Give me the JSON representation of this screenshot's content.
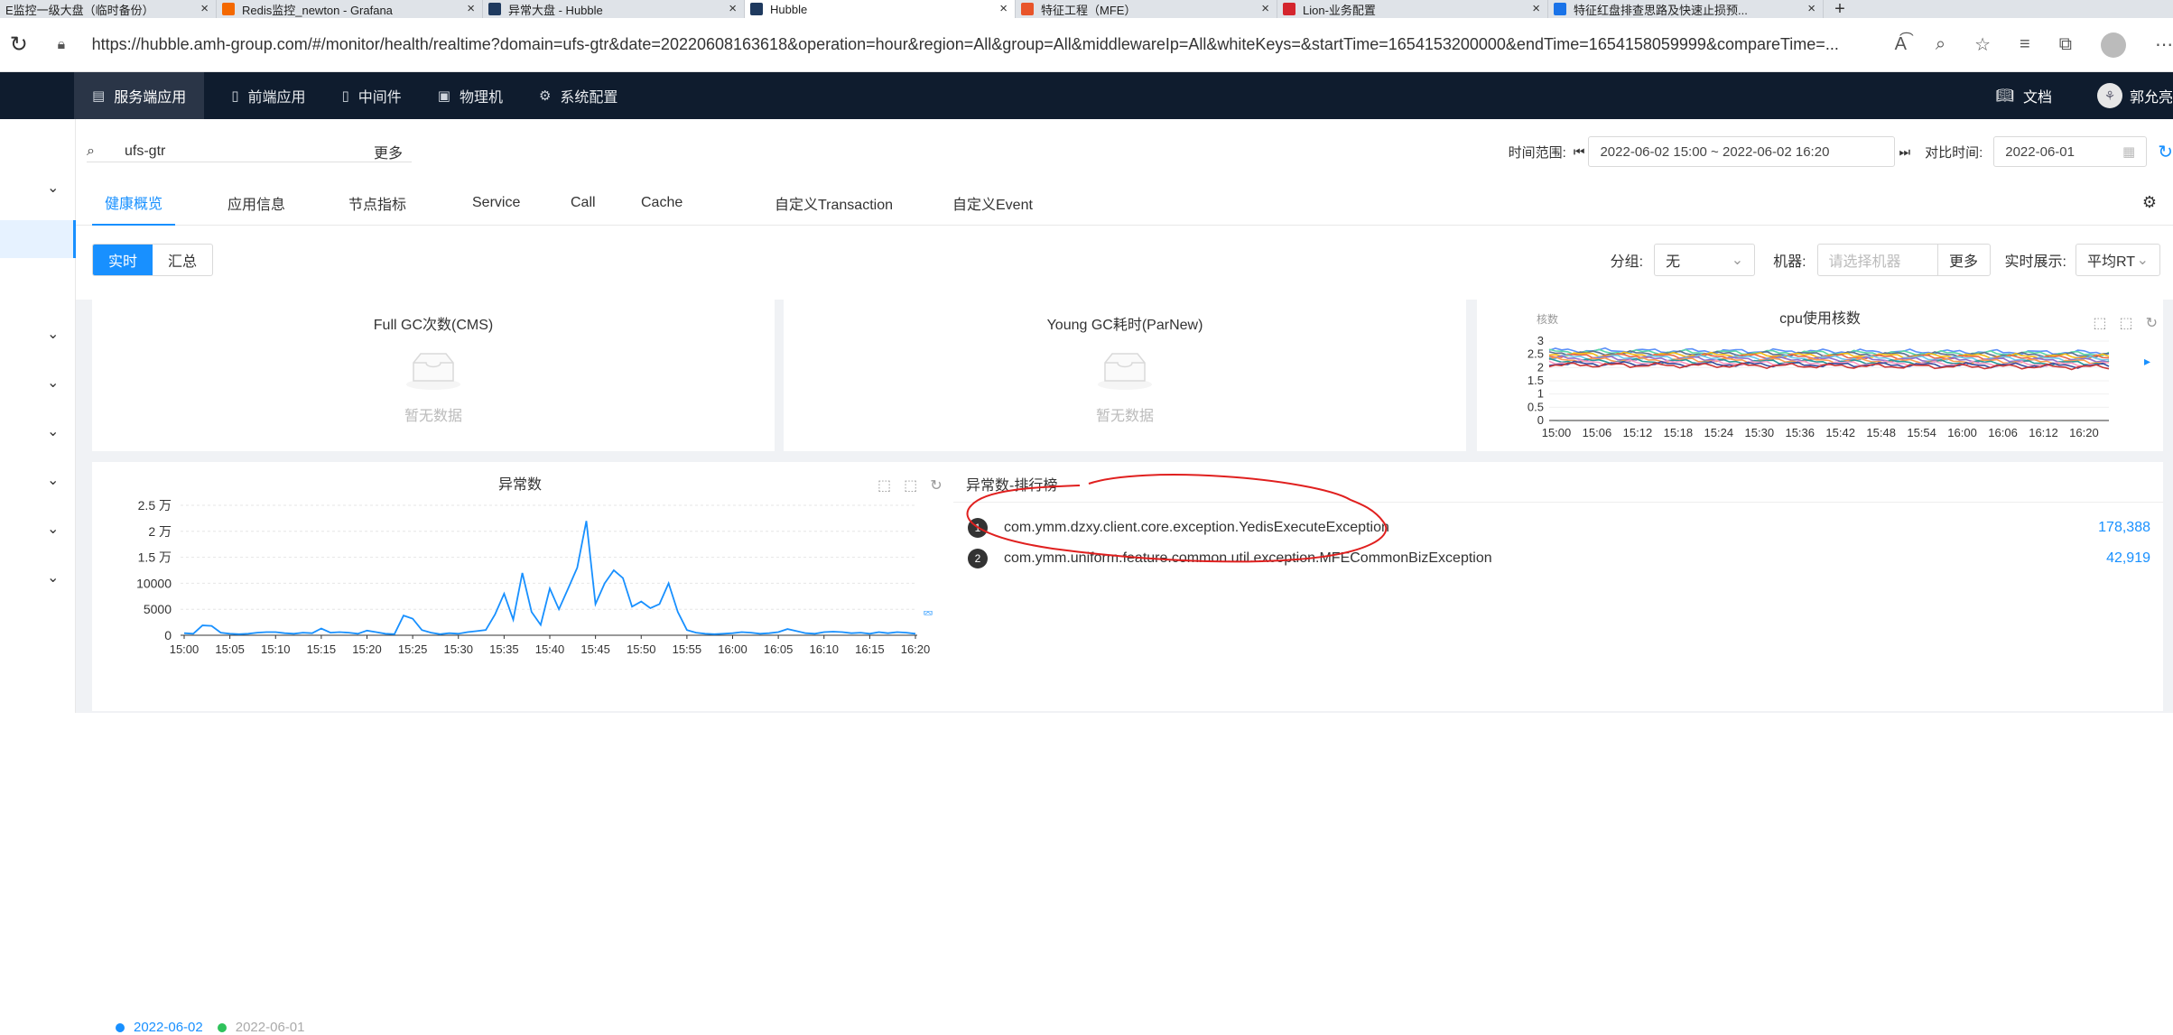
{
  "browser": {
    "tabs": [
      {
        "label": "E监控一级大盘（临时备份）",
        "icon": "dashboard-tab-icon",
        "color": "#f5f5f5"
      },
      {
        "label": "Redis监控_newton - Grafana",
        "icon": "grafana-icon",
        "color": "#f46800"
      },
      {
        "label": "异常大盘 - Hubble",
        "icon": "hubble-icon",
        "color": "#1f3a5f"
      },
      {
        "label": "Hubble",
        "icon": "hubble-icon",
        "color": "#1f3a5f"
      },
      {
        "label": "特征工程（MFE）",
        "icon": "mfe-icon",
        "color": "#e8542a"
      },
      {
        "label": "Lion-业务配置",
        "icon": "lion-icon",
        "color": "#d4252d"
      },
      {
        "label": "特征红盘排查思路及快速止损预...",
        "icon": "confluence-icon",
        "color": "#1a73e8"
      }
    ],
    "url": "https://hubble.amh-group.com/#/monitor/health/realtime?domain=ufs-gtr&date=20220608163618&operation=hour&region=All&group=All&middlewareIp=All&whiteKeys=&startTime=1654153200000&endTime=1654158059999&compareTime=..."
  },
  "header": {
    "nav": [
      {
        "label": "服务端应用",
        "icon": "server-app-icon"
      },
      {
        "label": "前端应用",
        "icon": "frontend-app-icon"
      },
      {
        "label": "中间件",
        "icon": "middleware-icon"
      },
      {
        "label": "物理机",
        "icon": "physical-machine-icon"
      },
      {
        "label": "系统配置",
        "icon": "settings-icon"
      }
    ],
    "docs_label": "文档",
    "user_name": "郭允亮"
  },
  "search": {
    "value": "ufs-gtr",
    "more_label": "更多"
  },
  "time": {
    "range_label": "时间范围:",
    "range_value": "2022-06-02 15:00 ~ 2022-06-02 16:20",
    "compare_label": "对比时间:",
    "compare_value": "2022-06-01"
  },
  "tabs": [
    "健康概览",
    "应用信息",
    "节点指标",
    "Service",
    "Call",
    "Cache",
    "自定义Transaction",
    "自定义Event"
  ],
  "filters": {
    "mode_realtime": "实时",
    "mode_summary": "汇总",
    "group_label": "分组:",
    "group_value": "无",
    "machine_label": "机器:",
    "machine_placeholder": "请选择机器",
    "more_label": "更多",
    "display_label": "实时展示:",
    "display_value": "平均RT"
  },
  "panels": {
    "full_gc_title": "Full GC次数(CMS)",
    "young_gc_title": "Young GC耗时(ParNew)",
    "empty_text": "暂无数据",
    "exceptions_title": "异常数",
    "ranking_title": "异常数-排行榜"
  },
  "ranking": [
    {
      "rank": "1",
      "name": "com.ymm.dzxy.client.core.exception.YedisExecuteException",
      "count": "178,388"
    },
    {
      "rank": "2",
      "name": "com.ymm.uniform.feature.common.util.exception.MFECommonBizException",
      "count": "42,919"
    }
  ],
  "colors": {
    "accent": "#1890ff",
    "header_bg": "#0f1c2e",
    "annotation": "#e0201f",
    "compare_series": "#2fc25b"
  },
  "chart_data": [
    {
      "type": "line",
      "title": "cpu使用核数",
      "ylabel": "核数",
      "x_ticks": [
        "15:00",
        "15:06",
        "15:12",
        "15:18",
        "15:24",
        "15:30",
        "15:36",
        "15:42",
        "15:48",
        "15:54",
        "16:00",
        "16:06",
        "16:12",
        "16:20"
      ],
      "y_ticks": [
        "3",
        "2.5",
        "2",
        "1.5",
        "1",
        "0.5",
        "0"
      ],
      "ylim": [
        0,
        3
      ],
      "series_colors": [
        "#5b8ff9",
        "#5ad8a6",
        "#5d7092",
        "#f6bd16",
        "#e8684a",
        "#6dc8ec",
        "#9270ca",
        "#ff9d4d",
        "#269a99",
        "#ff99c3",
        "#3a4fa0",
        "#c93737"
      ],
      "series_base": [
        2.65,
        2.6,
        2.55,
        2.5,
        2.45,
        2.4,
        2.35,
        2.3,
        2.25,
        2.2,
        2.15,
        2.1
      ]
    },
    {
      "type": "line",
      "title": "异常数",
      "x_ticks": [
        "15:00",
        "15:05",
        "15:10",
        "15:15",
        "15:20",
        "15:25",
        "15:30",
        "15:35",
        "15:40",
        "15:45",
        "15:50",
        "15:55",
        "16:00",
        "16:05",
        "16:10",
        "16:15",
        "16:20"
      ],
      "y_ticks": [
        "2.5 万",
        "2 万",
        "1.5 万",
        "10000",
        "5000",
        "0"
      ],
      "ylim": [
        0,
        25000
      ],
      "x": [
        "15:00",
        "15:01",
        "15:02",
        "15:03",
        "15:04",
        "15:05",
        "15:06",
        "15:07",
        "15:08",
        "15:09",
        "15:10",
        "15:11",
        "15:12",
        "15:13",
        "15:14",
        "15:15",
        "15:16",
        "15:17",
        "15:18",
        "15:19",
        "15:20",
        "15:21",
        "15:22",
        "15:23",
        "15:24",
        "15:25",
        "15:26",
        "15:27",
        "15:28",
        "15:29",
        "15:30",
        "15:31",
        "15:32",
        "15:33",
        "15:34",
        "15:35",
        "15:36",
        "15:37",
        "15:38",
        "15:39",
        "15:40",
        "15:41",
        "15:42",
        "15:43",
        "15:44",
        "15:45",
        "15:46",
        "15:47",
        "15:48",
        "15:49",
        "15:50",
        "15:51",
        "15:52",
        "15:53",
        "15:54",
        "15:55",
        "15:56",
        "15:57",
        "15:58",
        "15:59",
        "16:00",
        "16:01",
        "16:02",
        "16:03",
        "16:04",
        "16:05",
        "16:06",
        "16:07",
        "16:08",
        "16:09",
        "16:10",
        "16:11",
        "16:12",
        "16:13",
        "16:14",
        "16:15",
        "16:16",
        "16:17",
        "16:18",
        "16:19",
        "16:20"
      ],
      "series": [
        {
          "name": "2022-06-02",
          "color": "#1890ff",
          "values": [
            400,
            300,
            1900,
            1800,
            500,
            300,
            200,
            300,
            500,
            600,
            600,
            400,
            300,
            500,
            400,
            1300,
            500,
            600,
            500,
            300,
            900,
            600,
            300,
            200,
            3800,
            3200,
            1000,
            500,
            200,
            400,
            300,
            600,
            800,
            1000,
            4000,
            8000,
            3000,
            12000,
            4500,
            2000,
            9000,
            5000,
            9000,
            13000,
            22000,
            6000,
            10000,
            12500,
            11000,
            5500,
            6500,
            5200,
            6000,
            10000,
            4500,
            1000,
            500,
            300,
            200,
            300,
            400,
            600,
            500,
            300,
            400,
            600,
            1200,
            800,
            400,
            300,
            600,
            700,
            600,
            400,
            500,
            300,
            600,
            400,
            600,
            500,
            300
          ]
        },
        {
          "name": "2022-06-01",
          "color": "#2fc25b",
          "values": []
        }
      ]
    }
  ]
}
